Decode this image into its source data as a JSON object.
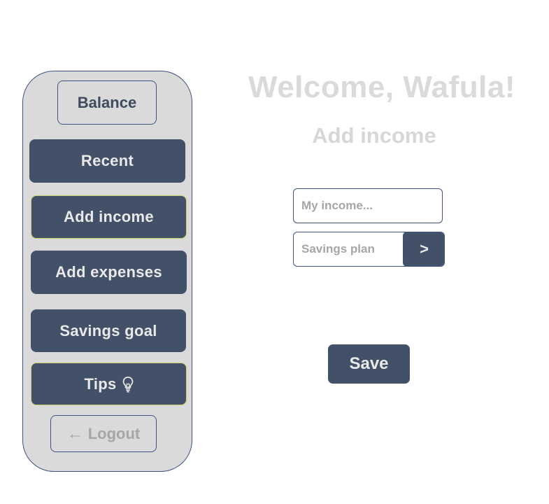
{
  "header": {
    "welcome": "Welcome, Wafula!",
    "subtitle": "Add income"
  },
  "sidebar": {
    "items": [
      {
        "label": "Balance"
      },
      {
        "label": "Recent"
      },
      {
        "label": "Add income"
      },
      {
        "label": "Add expenses"
      },
      {
        "label": "Savings goal"
      },
      {
        "label": "Tips",
        "icon": "lightbulb-icon"
      }
    ],
    "logout": {
      "arrow": "←",
      "label": "Logout"
    }
  },
  "form": {
    "income_placeholder": "My income...",
    "savings_placeholder": "Savings plan",
    "go_label": ">",
    "save_label": "Save"
  },
  "colors": {
    "primary": "#435168",
    "sidebar_bg": "#dadada",
    "border": "#3f5283",
    "highlight_border": "#c9cf6a",
    "muted_text": "#a6a6a6"
  }
}
